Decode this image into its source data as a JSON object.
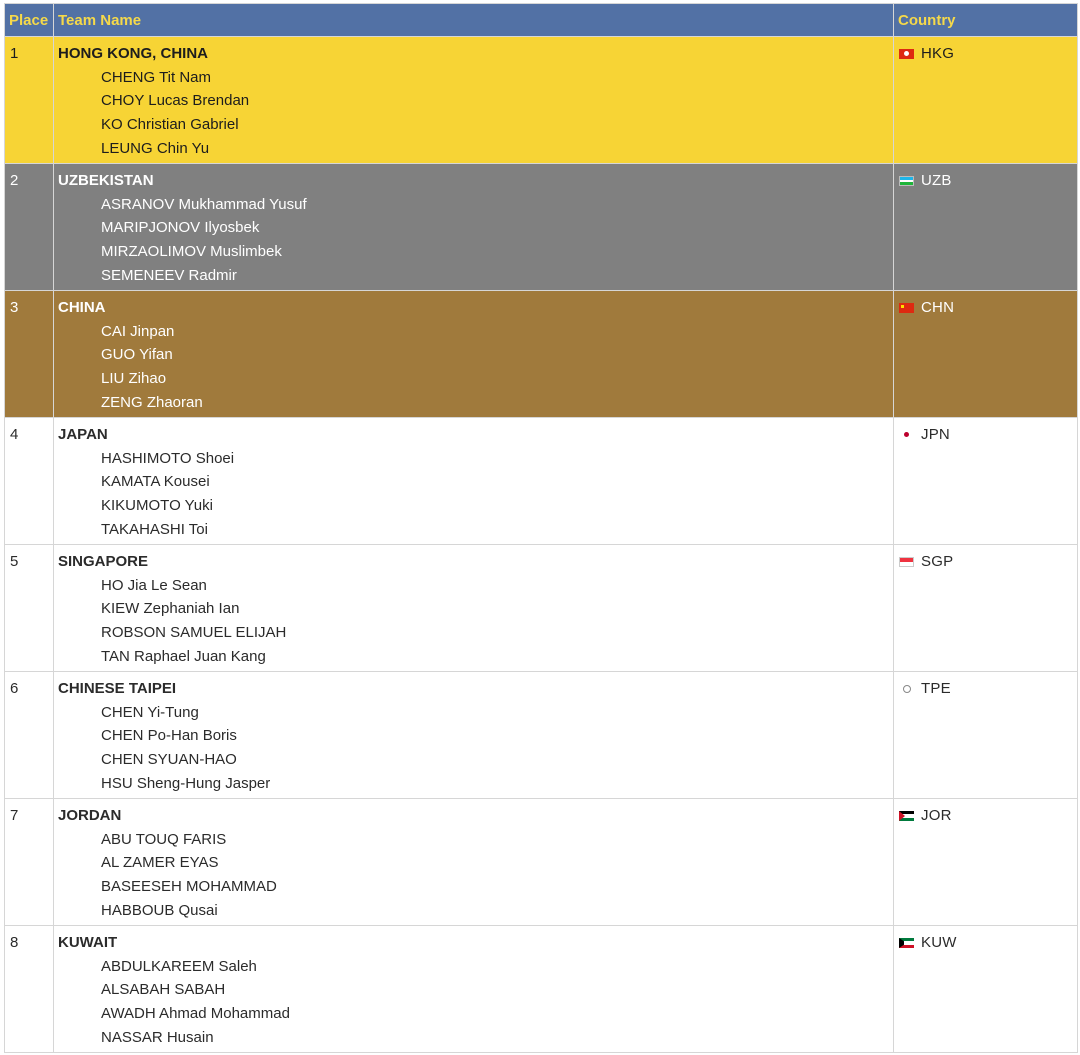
{
  "headers": {
    "place": "Place",
    "team": "Team Name",
    "country": "Country"
  },
  "colors": {
    "header_bg": "#5271a5",
    "header_text": "#f5d94a",
    "gold": "#f7d435",
    "silver": "#808080",
    "bronze": "#a07a3c"
  },
  "rows": [
    {
      "place": "1",
      "team": "HONG KONG, CHINA",
      "country": "HKG",
      "flag": "hkg-flag-icon",
      "medal": "gold",
      "members": [
        "CHENG Tit Nam",
        "CHOY Lucas Brendan",
        "KO Christian Gabriel",
        "LEUNG Chin Yu"
      ]
    },
    {
      "place": "2",
      "team": "UZBEKISTAN",
      "country": "UZB",
      "flag": "uzb-flag-icon",
      "medal": "silver",
      "members": [
        "ASRANOV Mukhammad Yusuf",
        "MARIPJONOV Ilyosbek",
        "MIRZAOLIMOV Muslimbek",
        "SEMENEEV Radmir"
      ]
    },
    {
      "place": "3",
      "team": "CHINA",
      "country": "CHN",
      "flag": "chn-flag-icon",
      "medal": "bronze",
      "members": [
        "CAI Jinpan",
        "GUO Yifan",
        "LIU Zihao",
        "ZENG Zhaoran"
      ]
    },
    {
      "place": "4",
      "team": "JAPAN",
      "country": "JPN",
      "flag": "jpn-flag-icon",
      "medal": "none",
      "members": [
        "HASHIMOTO Shoei",
        "KAMATA Kousei",
        "KIKUMOTO Yuki",
        "TAKAHASHI Toi"
      ]
    },
    {
      "place": "5",
      "team": "SINGAPORE",
      "country": "SGP",
      "flag": "sgp-flag-icon",
      "medal": "none",
      "members": [
        "HO Jia Le Sean",
        "KIEW Zephaniah Ian",
        "ROBSON SAMUEL ELIJAH",
        "TAN Raphael Juan Kang"
      ]
    },
    {
      "place": "6",
      "team": "CHINESE TAIPEI",
      "country": "TPE",
      "flag": "tpe-flag-icon",
      "medal": "none",
      "members": [
        "CHEN Yi-Tung",
        "CHEN Po-Han Boris",
        "CHEN SYUAN-HAO",
        "HSU Sheng-Hung Jasper"
      ]
    },
    {
      "place": "7",
      "team": "JORDAN",
      "country": "JOR",
      "flag": "jor-flag-icon",
      "medal": "none",
      "members": [
        "ABU TOUQ FARIS",
        "AL ZAMER EYAS",
        "BASEESEH MOHAMMAD",
        "HABBOUB Qusai"
      ]
    },
    {
      "place": "8",
      "team": "KUWAIT",
      "country": "KUW",
      "flag": "kuw-flag-icon",
      "medal": "none",
      "members": [
        "ABDULKAREEM Saleh",
        "ALSABAH SABAH",
        "AWADH Ahmad Mohammad",
        "NASSAR Husain"
      ]
    }
  ]
}
